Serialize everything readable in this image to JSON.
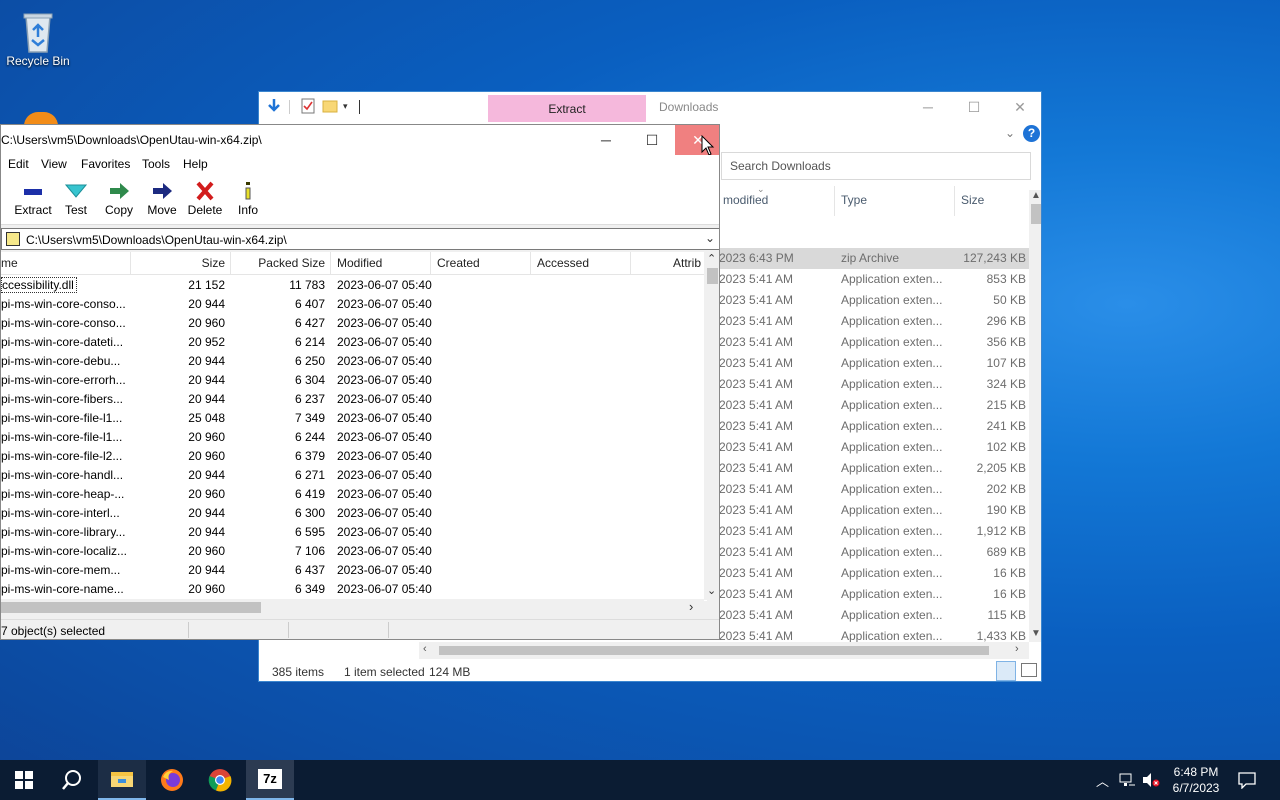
{
  "desktop": {
    "recycle_bin_label": "Recycle Bin"
  },
  "explorer": {
    "tab_extract": "Extract",
    "title": "Downloads",
    "search_placeholder": "Search Downloads",
    "columns": {
      "modified": "modified",
      "type": "Type",
      "size": "Size"
    },
    "rows": [
      {
        "modified": "2023 6:43 PM",
        "type": "zip Archive",
        "size": "127,243 KB",
        "selected": true
      },
      {
        "modified": "2023 5:41 AM",
        "type": "Application exten...",
        "size": "853 KB"
      },
      {
        "modified": "2023 5:41 AM",
        "type": "Application exten...",
        "size": "50 KB"
      },
      {
        "modified": "2023 5:41 AM",
        "type": "Application exten...",
        "size": "296 KB"
      },
      {
        "modified": "2023 5:41 AM",
        "type": "Application exten...",
        "size": "356 KB"
      },
      {
        "modified": "2023 5:41 AM",
        "type": "Application exten...",
        "size": "107 KB"
      },
      {
        "modified": "2023 5:41 AM",
        "type": "Application exten...",
        "size": "324 KB"
      },
      {
        "modified": "2023 5:41 AM",
        "type": "Application exten...",
        "size": "215 KB"
      },
      {
        "modified": "2023 5:41 AM",
        "type": "Application exten...",
        "size": "241 KB"
      },
      {
        "modified": "2023 5:41 AM",
        "type": "Application exten...",
        "size": "102 KB"
      },
      {
        "modified": "2023 5:41 AM",
        "type": "Application exten...",
        "size": "2,205 KB"
      },
      {
        "modified": "2023 5:41 AM",
        "type": "Application exten...",
        "size": "202 KB"
      },
      {
        "modified": "2023 5:41 AM",
        "type": "Application exten...",
        "size": "190 KB"
      },
      {
        "modified": "2023 5:41 AM",
        "type": "Application exten...",
        "size": "1,912 KB"
      },
      {
        "modified": "2023 5:41 AM",
        "type": "Application exten...",
        "size": "689 KB"
      },
      {
        "modified": "2023 5:41 AM",
        "type": "Application exten...",
        "size": "16 KB"
      },
      {
        "modified": "2023 5:41 AM",
        "type": "Application exten...",
        "size": "16 KB"
      },
      {
        "modified": "2023 5:41 AM",
        "type": "Application exten...",
        "size": "115 KB"
      },
      {
        "modified": "2023 5:41 AM",
        "type": "Application exten...",
        "size": "1,433 KB"
      }
    ],
    "status": {
      "items": "385 items",
      "selected": "1 item selected",
      "size": "124 MB"
    }
  },
  "zip": {
    "title": "C:\\Users\\vm5\\Downloads\\OpenUtau-win-x64.zip\\",
    "menu": [
      "Edit",
      "View",
      "Favorites",
      "Tools",
      "Help"
    ],
    "toolbar": {
      "extract": "Extract",
      "test": "Test",
      "copy": "Copy",
      "move": "Move",
      "delete": "Delete",
      "info": "Info"
    },
    "address": "C:\\Users\\vm5\\Downloads\\OpenUtau-win-x64.zip\\",
    "columns": {
      "name": "me",
      "size": "Size",
      "packed": "Packed Size",
      "modified": "Modified",
      "created": "Created",
      "accessed": "Accessed",
      "attrib": "Attrib"
    },
    "rows": [
      {
        "name": "ccessibility.dll",
        "size": "21 152",
        "packed": "11 783",
        "modified": "2023-06-07 05:40"
      },
      {
        "name": "pi-ms-win-core-conso...",
        "size": "20 944",
        "packed": "6 407",
        "modified": "2023-06-07 05:40"
      },
      {
        "name": "pi-ms-win-core-conso...",
        "size": "20 960",
        "packed": "6 427",
        "modified": "2023-06-07 05:40"
      },
      {
        "name": "pi-ms-win-core-dateti...",
        "size": "20 952",
        "packed": "6 214",
        "modified": "2023-06-07 05:40"
      },
      {
        "name": "pi-ms-win-core-debu...",
        "size": "20 944",
        "packed": "6 250",
        "modified": "2023-06-07 05:40"
      },
      {
        "name": "pi-ms-win-core-errorh...",
        "size": "20 944",
        "packed": "6 304",
        "modified": "2023-06-07 05:40"
      },
      {
        "name": "pi-ms-win-core-fibers...",
        "size": "20 944",
        "packed": "6 237",
        "modified": "2023-06-07 05:40"
      },
      {
        "name": "pi-ms-win-core-file-l1...",
        "size": "25 048",
        "packed": "7 349",
        "modified": "2023-06-07 05:40"
      },
      {
        "name": "pi-ms-win-core-file-l1...",
        "size": "20 960",
        "packed": "6 244",
        "modified": "2023-06-07 05:40"
      },
      {
        "name": "pi-ms-win-core-file-l2...",
        "size": "20 960",
        "packed": "6 379",
        "modified": "2023-06-07 05:40"
      },
      {
        "name": "pi-ms-win-core-handl...",
        "size": "20 944",
        "packed": "6 271",
        "modified": "2023-06-07 05:40"
      },
      {
        "name": "pi-ms-win-core-heap-...",
        "size": "20 960",
        "packed": "6 419",
        "modified": "2023-06-07 05:40"
      },
      {
        "name": "pi-ms-win-core-interl...",
        "size": "20 944",
        "packed": "6 300",
        "modified": "2023-06-07 05:40"
      },
      {
        "name": "pi-ms-win-core-library...",
        "size": "20 944",
        "packed": "6 595",
        "modified": "2023-06-07 05:40"
      },
      {
        "name": "pi-ms-win-core-localiz...",
        "size": "20 960",
        "packed": "7 106",
        "modified": "2023-06-07 05:40"
      },
      {
        "name": "pi-ms-win-core-mem...",
        "size": "20 944",
        "packed": "6 437",
        "modified": "2023-06-07 05:40"
      },
      {
        "name": "pi-ms-win-core-name...",
        "size": "20 960",
        "packed": "6 349",
        "modified": "2023-06-07 05:40"
      }
    ],
    "status": "7 object(s) selected"
  },
  "taskbar": {
    "time": "6:48 PM",
    "date": "6/7/2023",
    "sevenzip_label": "7z"
  },
  "colors": {
    "close_hover": "#e81123",
    "extract_tab": "#f5b8dc",
    "taskbar": "#0b1c33"
  }
}
